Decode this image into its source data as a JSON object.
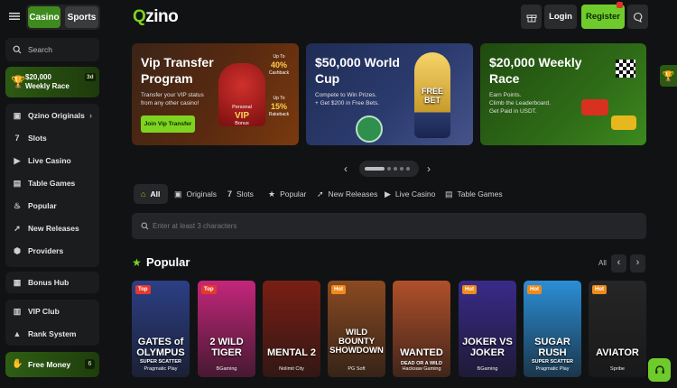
{
  "header": {
    "tab_casino": "Casino",
    "tab_sports": "Sports",
    "logo_prefix": "Q",
    "logo_text": "zino",
    "login_label": "Login",
    "register_label": "Register"
  },
  "sidebar": {
    "search_label": "Search",
    "promo": {
      "title": "$20,000\nWeekly Race",
      "count": "3d"
    },
    "items": [
      {
        "label": "Qzino Originals",
        "icon": "originals-icon"
      },
      {
        "label": "Slots",
        "icon": "slots-icon"
      },
      {
        "label": "Live Casino",
        "icon": "live-casino-icon"
      },
      {
        "label": "Table Games",
        "icon": "table-games-icon"
      },
      {
        "label": "Popular",
        "icon": "popular-icon"
      },
      {
        "label": "New Releases",
        "icon": "rocket-icon"
      },
      {
        "label": "Providers",
        "icon": "providers-icon"
      }
    ],
    "bonus_hub": "Bonus Hub",
    "vip_club": "VIP Club",
    "rank_system": "Rank System",
    "free_money": "Free Money",
    "free_money_count": "6"
  },
  "banners": [
    {
      "title": "Vip Transfer\nProgram",
      "subtitle": "Transfer your VIP status\nfrom any other casino!",
      "button": "Join Vip Transfer",
      "tag_personal": "Personal",
      "tag_vip": "VIP",
      "tag_bonus": "Bonus",
      "tag_up1": "Up To",
      "tag_40": "40%",
      "tag_cashback": "Cashback",
      "tag_up2": "Up To",
      "tag_15": "15%",
      "tag_rakeback": "Rakeback"
    },
    {
      "title": "$50,000 World\nCup",
      "subtitle": "Compete to Win Prizes.\n+ Get $200 in Free Bets.",
      "trophy_text": "FREE\nBET"
    },
    {
      "title": "$20,000 Weekly\nRace",
      "subtitle": "Earn Points.\nClimb the Leaderboard.\nGet Paid in USDT."
    }
  ],
  "categories": [
    {
      "label": "All",
      "icon": "home-icon",
      "active": true
    },
    {
      "label": "Originals",
      "icon": "originals-icon"
    },
    {
      "label": "Slots",
      "icon": "slots-icon"
    },
    {
      "label": "Popular",
      "icon": "star-icon"
    },
    {
      "label": "New Releases",
      "icon": "rocket-icon"
    },
    {
      "label": "Live Casino",
      "icon": "live-casino-icon"
    },
    {
      "label": "Table Games",
      "icon": "table-games-icon"
    }
  ],
  "search": {
    "placeholder": "Enter at least 3 characters"
  },
  "section": {
    "title": "Popular",
    "all_label": "All"
  },
  "games": [
    {
      "title": "GATES of\nOLYMPUS",
      "sub": "SUPER SCATTER",
      "provider": "Pragmatic Play",
      "badge": "Top",
      "bg": "#2c3f86"
    },
    {
      "title": "2 WILD\nTIGER",
      "sub": "",
      "provider": "BGaming",
      "badge": "Top",
      "bg": "#c4267b"
    },
    {
      "title": "MENTAL 2",
      "sub": "",
      "provider": "Nolimit City",
      "badge": "",
      "bg": "#7a1f14"
    },
    {
      "title": "WILD\nBOUNTY\nSHOWDOWN",
      "sub": "",
      "provider": "PG Soft",
      "badge": "Hot",
      "bg": "#8a4a21"
    },
    {
      "title": "WANTED",
      "sub": "DEAD OR A WILD",
      "provider": "Hacksaw Gaming",
      "badge": "",
      "bg": "#b0502a"
    },
    {
      "title": "JOKER VS\nJOKER",
      "sub": "",
      "provider": "BGaming",
      "badge": "Hot",
      "bg": "#3a2a8a"
    },
    {
      "title": "SUGAR\nRUSH",
      "sub": "SUPER SCATTER",
      "provider": "Pragmatic Play",
      "badge": "Hot",
      "bg": "#2b8ed6"
    },
    {
      "title": "AVIATOR",
      "sub": "",
      "provider": "Spribe",
      "badge": "Hot",
      "bg": "#262626"
    }
  ],
  "colors": {
    "accent": "#7ed321",
    "hot": "#f08a1c",
    "top": "#e5392e"
  }
}
